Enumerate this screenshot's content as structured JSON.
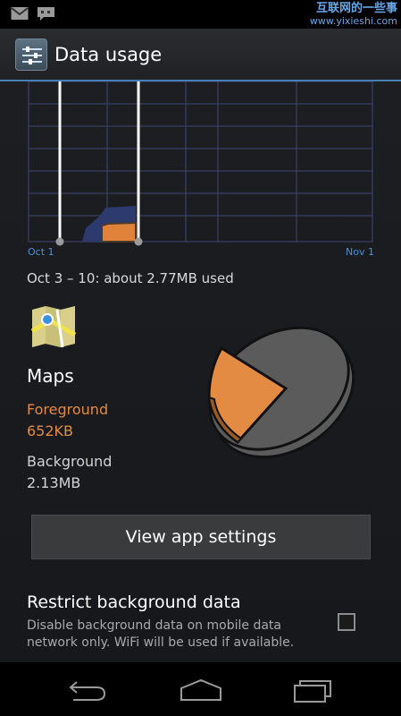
{
  "status_bar": {
    "icons": [
      "gmail-icon",
      "talk-icon"
    ],
    "watermark_line1": "互联网的一些事",
    "watermark_line2": "www.yixieshi.com"
  },
  "action_bar": {
    "icon": "settings-sliders-icon",
    "title": "Data usage"
  },
  "chart": {
    "start_label": "Oct 1",
    "end_label": "Nov 1",
    "colors": {
      "grid": "#3f4673",
      "usage": "#2c3a6e",
      "selected": "#e1823a",
      "handle": "#ffffff",
      "axis_label": "#4f8fd6"
    }
  },
  "summary": {
    "period_text": "Oct 3 – 10: about 2.77MB used"
  },
  "app": {
    "icon": "maps-app-icon",
    "name": "Maps",
    "foreground_label": "Foreground",
    "foreground_value": "652KB",
    "background_label": "Background",
    "background_value": "2.13MB",
    "colors": {
      "foreground": "#e38a43",
      "background": "#5b5b5b"
    }
  },
  "actions": {
    "view_settings_label": "View app settings"
  },
  "restrict": {
    "title": "Restrict background data",
    "description": "Disable background data on mobile data network only. WiFi will be used if available.",
    "checked": false
  },
  "nav_bar": {
    "icons": [
      "back-icon",
      "home-icon",
      "recent-apps-icon"
    ]
  }
}
